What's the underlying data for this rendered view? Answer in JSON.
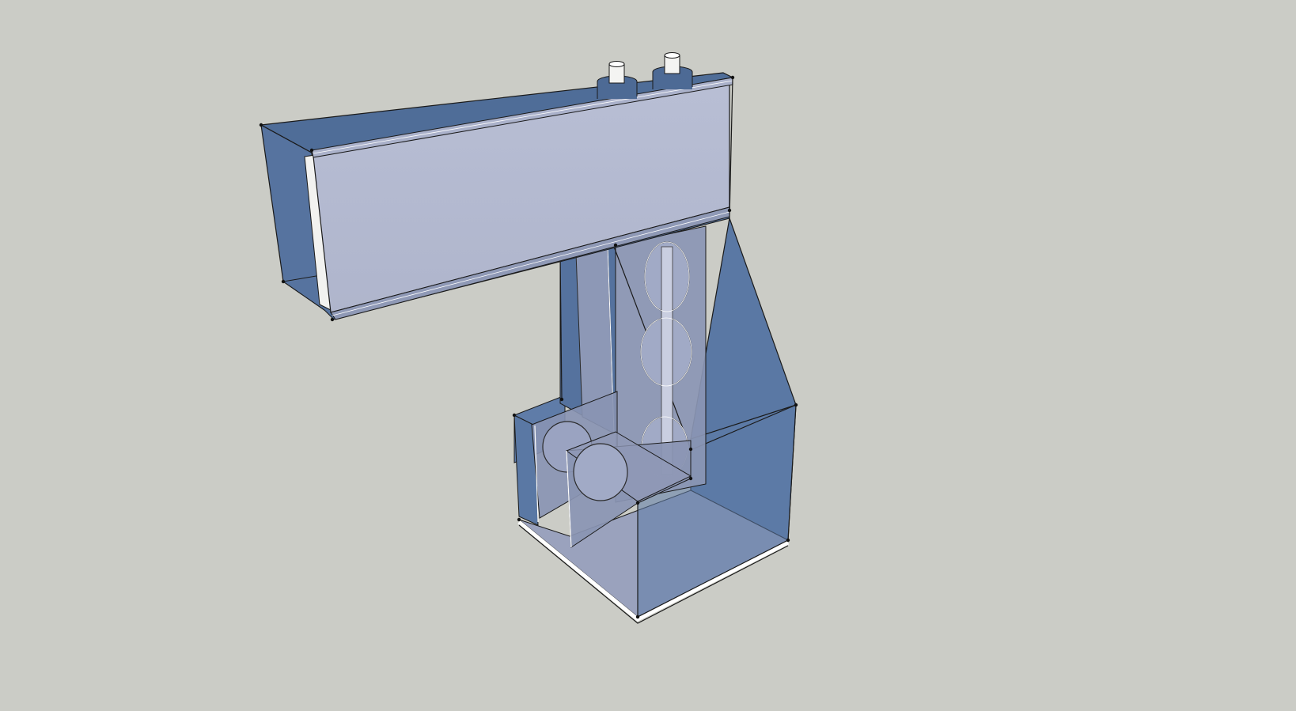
{
  "viewport": {
    "background_color": "#cbccc6",
    "render_style": "x-ray translucent shaded 3D model"
  },
  "colors": {
    "dark_face": "#4f6d98",
    "mid_face": "#5d7aa6",
    "light_face": "#b3b9d0",
    "pale_face": "#9ea4bf",
    "translucent_panel": "#8c97b5",
    "edge": "#1a1a1a",
    "highlight_edge": "#ffffff",
    "pipe_white": "#f4f4f2"
  },
  "model": {
    "description_parts": [
      "top-beam-box",
      "vertical-column-panel",
      "perforated-panel",
      "lower-base-box",
      "front-slotted-panels",
      "vertical-pipes"
    ]
  }
}
